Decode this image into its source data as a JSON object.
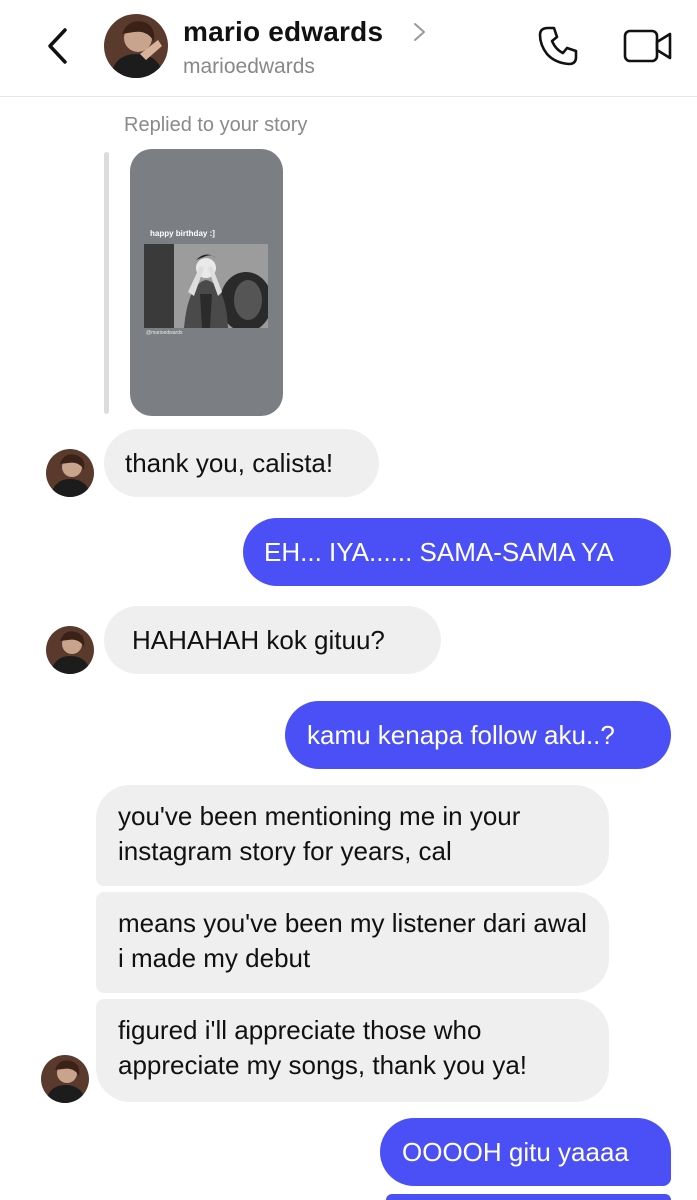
{
  "header": {
    "name": "mario edwards",
    "handle": "marioedwards"
  },
  "story_reply": {
    "label": "Replied to your story",
    "story_caption": "happy birthday :]",
    "story_tag": "@marioedwards"
  },
  "messages": [
    {
      "from": "them",
      "text": "thank you, calista!"
    },
    {
      "from": "me",
      "text": "EH... IYA...... SAMA-SAMA YA"
    },
    {
      "from": "them",
      "text": "HAHAHAH kok gituu?"
    },
    {
      "from": "me",
      "text": "kamu kenapa follow aku..?"
    },
    {
      "from": "them",
      "text": "you've been mentioning me in your instagram story for years, cal"
    },
    {
      "from": "them",
      "text": "means you've been my listener dari awal i made my debut"
    },
    {
      "from": "them",
      "text": "figured i'll appreciate those who appreciate my songs, thank you ya!"
    },
    {
      "from": "me",
      "text": "OOOOH gitu yaaaa"
    }
  ],
  "colors": {
    "outgoing_bubble": "#4a50f5",
    "incoming_bubble": "#efefef"
  },
  "icons": [
    "back-arrow-icon",
    "chevron-right-icon",
    "phone-icon",
    "video-camera-icon"
  ]
}
